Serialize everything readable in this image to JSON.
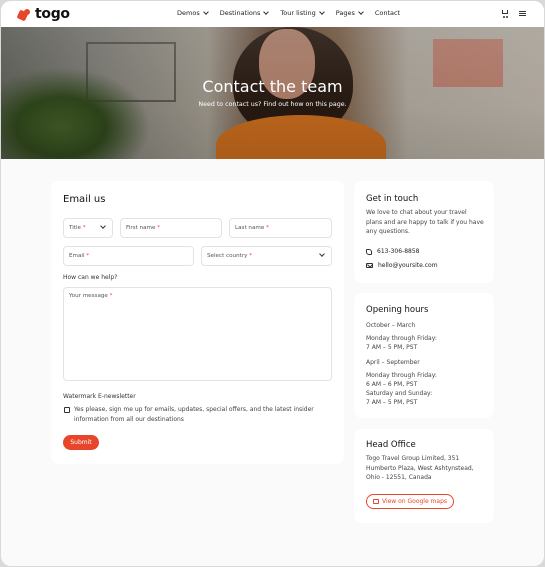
{
  "header": {
    "logo_text": "togo",
    "nav": [
      {
        "label": "Demos",
        "has_dropdown": true
      },
      {
        "label": "Destinations",
        "has_dropdown": true
      },
      {
        "label": "Tour listing",
        "has_dropdown": true
      },
      {
        "label": "Pages",
        "has_dropdown": true
      },
      {
        "label": "Contact",
        "has_dropdown": false
      }
    ],
    "icons": [
      "cart-icon",
      "menu-icon"
    ]
  },
  "hero": {
    "title": "Contact the team",
    "subtitle": "Need to contact us? Find out how on this page."
  },
  "form": {
    "title": "Email us",
    "title_select": "Title",
    "first_name": "First name",
    "last_name": "Last name",
    "email": "Email",
    "country": "Select country",
    "required_mark": "*",
    "help_label": "How can we help?",
    "message_placeholder": "Your message",
    "newsletter_label": "Watermark E-newsletter",
    "newsletter_text": "Yes please, sign me up for emails, updates, special offers, and the latest insider information from all our destinations",
    "submit": "Submit"
  },
  "get_in_touch": {
    "title": "Get in touch",
    "text": "We love to chat about your travel plans and are happy to talk if you have any questions.",
    "phone": "613-306-8858",
    "email": "hello@yoursite.com"
  },
  "opening_hours": {
    "title": "Opening hours",
    "season1": "October – March",
    "season1_line1": "Monday through Friday:",
    "season1_line2": "7 AM – 5 PM, PST",
    "season2": "April – September",
    "season2_line1": "Monday through Friday:",
    "season2_line2": "6 AM – 6 PM, PST",
    "season2_line3": "Saturday and Sunday:",
    "season2_line4": "7 AM – 5 PM, PST"
  },
  "head_office": {
    "title": "Head Office",
    "address": "Togo Travel Group Limited, 351 Humberto Plaza, West Ashtynstead, Ohio - 12551, Canada",
    "map_button": "View on Google maps"
  },
  "colors": {
    "accent": "#e8462b",
    "hero_shirt": "#e27a22"
  }
}
